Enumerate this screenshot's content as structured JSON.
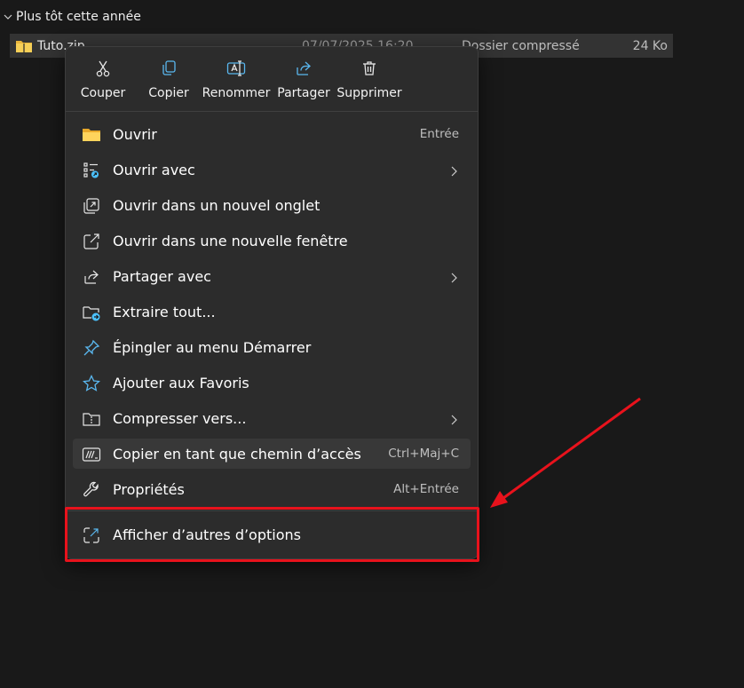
{
  "explorer": {
    "group_label": "Plus tôt cette année",
    "file": {
      "name": "Tuto.zip",
      "date": "07/07/2025 16:20",
      "type": "Dossier compressé",
      "size": "24 Ko"
    }
  },
  "quick_actions": [
    {
      "label": "Couper",
      "icon": "scissors-icon"
    },
    {
      "label": "Copier",
      "icon": "copy-icon"
    },
    {
      "label": "Renommer",
      "icon": "rename-icon"
    },
    {
      "label": "Partager",
      "icon": "share-icon"
    },
    {
      "label": "Supprimer",
      "icon": "trash-icon"
    }
  ],
  "menu_items": [
    {
      "label": "Ouvrir",
      "shortcut": "Entrée",
      "icon": "folder-icon"
    },
    {
      "label": "Ouvrir avec",
      "shortcut": "",
      "icon": "open-with-icon",
      "submenu": true
    },
    {
      "label": "Ouvrir dans un nouvel onglet",
      "shortcut": "",
      "icon": "new-tab-icon"
    },
    {
      "label": "Ouvrir dans une nouvelle fenêtre",
      "shortcut": "",
      "icon": "new-window-icon"
    },
    {
      "label": "Partager avec",
      "shortcut": "",
      "icon": "share-with-icon",
      "submenu": true
    },
    {
      "label": "Extraire tout...",
      "shortcut": "",
      "icon": "extract-icon"
    },
    {
      "label": "Épingler au menu Démarrer",
      "shortcut": "",
      "icon": "pin-icon"
    },
    {
      "label": "Ajouter aux Favoris",
      "shortcut": "",
      "icon": "star-icon"
    },
    {
      "label": "Compresser vers...",
      "shortcut": "",
      "icon": "compress-icon",
      "submenu": true
    },
    {
      "label": "Copier en tant que chemin d’accès",
      "shortcut": "Ctrl+Maj+C",
      "icon": "copy-path-icon",
      "hovered": true
    },
    {
      "label": "Propriétés",
      "shortcut": "Alt+Entrée",
      "icon": "wrench-icon"
    }
  ],
  "more_options": {
    "label": "Afficher d’autres d’options",
    "icon": "more-options-icon"
  },
  "colors": {
    "menu_bg": "#2c2c2c",
    "hover_bg": "#383838",
    "accent": "#4cc2ff",
    "annotation": "#e8121c"
  }
}
